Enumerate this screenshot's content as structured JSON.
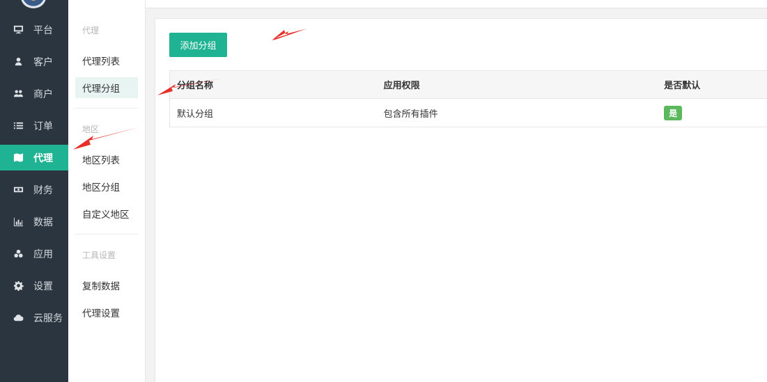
{
  "sidebar": {
    "items": [
      {
        "label": "平台",
        "icon": "monitor-icon"
      },
      {
        "label": "客户",
        "icon": "user-icon"
      },
      {
        "label": "商户",
        "icon": "users-icon"
      },
      {
        "label": "订单",
        "icon": "list-icon"
      },
      {
        "label": "代理",
        "icon": "map-icon",
        "active": true
      },
      {
        "label": "财务",
        "icon": "money-icon"
      },
      {
        "label": "数据",
        "icon": "bar-chart-icon"
      },
      {
        "label": "应用",
        "icon": "cubes-icon"
      },
      {
        "label": "设置",
        "icon": "gear-icon"
      },
      {
        "label": "云服务",
        "icon": "cloud-icon"
      }
    ]
  },
  "submenu": {
    "sections": [
      {
        "heading": "代理",
        "items": [
          "代理列表",
          "代理分组"
        ]
      },
      {
        "heading": "地区",
        "items": [
          "地区列表",
          "地区分组",
          "自定义地区"
        ]
      },
      {
        "heading": "工具设置",
        "items": [
          "复制数据",
          "代理设置"
        ]
      }
    ],
    "active_item": "代理分组"
  },
  "main": {
    "add_button": "添加分组",
    "table": {
      "headers": [
        "分组名称",
        "应用权限",
        "是否默认"
      ],
      "rows": [
        {
          "name": "默认分组",
          "permission": "包含所有插件",
          "is_default": "是"
        }
      ]
    }
  },
  "colors": {
    "sidebar_bg": "#2b3540",
    "accent": "#1fb293",
    "badge": "#5cb85c",
    "annotation": "#e8302a"
  }
}
